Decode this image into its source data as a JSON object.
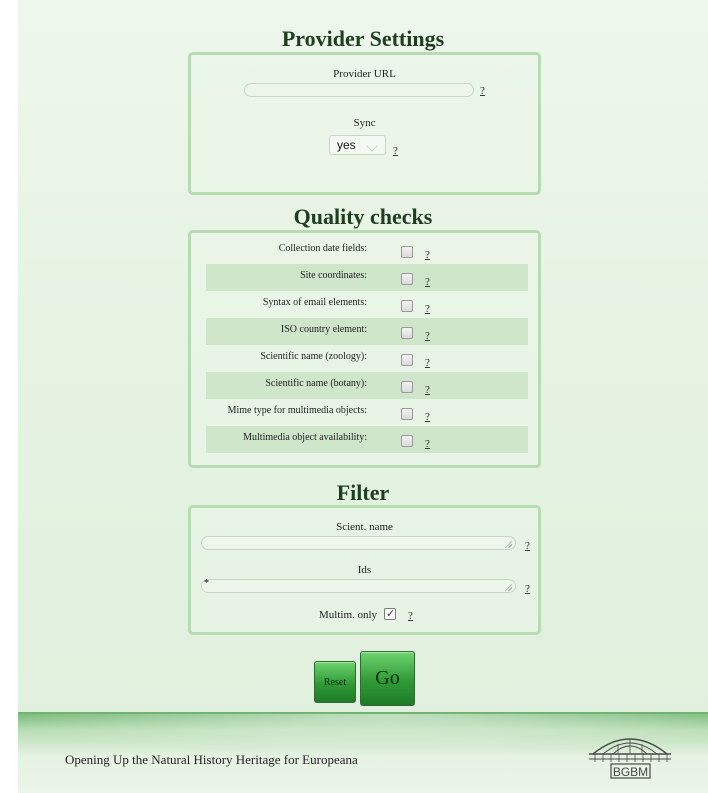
{
  "provider": {
    "title": "Provider Settings",
    "url_label": "Provider URL",
    "url_value": "",
    "sync_label": "Sync",
    "sync_value": "yes",
    "help": "?"
  },
  "quality": {
    "title": "Quality checks",
    "rows": [
      {
        "label": "Collection date fields:",
        "checked": false
      },
      {
        "label": "Site coordinates:",
        "checked": false
      },
      {
        "label": "Syntax of email elements:",
        "checked": false
      },
      {
        "label": "ISO country element:",
        "checked": false
      },
      {
        "label": "Scientific name (zoology):",
        "checked": false
      },
      {
        "label": "Scientific name (botany):",
        "checked": false
      },
      {
        "label": "Mime type for multimedia objects:",
        "checked": false
      },
      {
        "label": "Multimedia object availability:",
        "checked": false
      }
    ],
    "help": "?"
  },
  "filter": {
    "title": "Filter",
    "scient_label": "Scient. name",
    "scient_value": "",
    "ids_label": "Ids",
    "ids_value": "*",
    "multim_label": "Multim. only",
    "multim_checked": true,
    "help": "?"
  },
  "buttons": {
    "reset": "Reset",
    "go": "Go"
  },
  "footer": {
    "text": "Opening Up the Natural History Heritage for Europeana",
    "logo_text": "BGBM"
  },
  "colors": {
    "accent": "#2f9a36",
    "panel_border": "#b7dcb3",
    "row_alt": "#cfe6cb"
  }
}
